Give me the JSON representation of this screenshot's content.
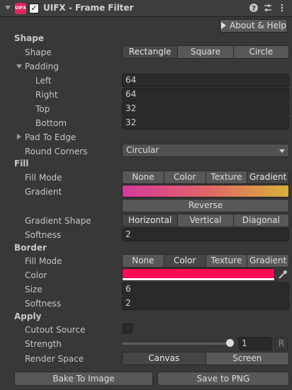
{
  "header": {
    "logo_text": "UIFX",
    "enabled": true,
    "title": "UIFX - Frame Filter",
    "icons": [
      "help-icon",
      "preset-icon",
      "menu-icon"
    ]
  },
  "about_button": "About & Help",
  "shape": {
    "section": "Shape",
    "shape_label": "Shape",
    "options": [
      "Rectangle",
      "Square",
      "Circle"
    ],
    "selected": "Rectangle",
    "padding_label": "Padding",
    "padding": {
      "left_label": "Left",
      "left": "64",
      "right_label": "Right",
      "right": "64",
      "top_label": "Top",
      "top": "32",
      "bottom_label": "Bottom",
      "bottom": "32"
    },
    "pad_to_edge_label": "Pad To Edge",
    "round_corners_label": "Round Corners",
    "round_corners_value": "Circular"
  },
  "fill": {
    "section": "Fill",
    "mode_label": "Fill Mode",
    "mode_options": [
      "None",
      "Color",
      "Texture",
      "Gradient"
    ],
    "mode_selected": "Gradient",
    "gradient_label": "Gradient",
    "gradient_colors": [
      "#d63a9a",
      "#e0646a",
      "#d9b03a"
    ],
    "reverse_button": "Reverse",
    "gradient_shape_label": "Gradient Shape",
    "gradient_shape_options": [
      "Horizontal",
      "Vertical",
      "Diagonal"
    ],
    "gradient_shape_selected": "Horizontal",
    "softness_label": "Softness",
    "softness": "2"
  },
  "border": {
    "section": "Border",
    "mode_label": "Fill Mode",
    "mode_options": [
      "None",
      "Color",
      "Texture",
      "Gradient"
    ],
    "mode_selected": "Color",
    "color_label": "Color",
    "color": "#ff0b55",
    "size_label": "Size",
    "size": "6",
    "softness_label": "Softness",
    "softness": "2"
  },
  "apply": {
    "section": "Apply",
    "cutout_label": "Cutout Source",
    "cutout_checked": false,
    "strength_label": "Strength",
    "strength": "1",
    "strength_fraction": 1.0,
    "reset_label": "R",
    "render_space_label": "Render Space",
    "render_space_options": [
      "Canvas",
      "Screen"
    ],
    "render_space_selected": "Canvas"
  },
  "footer": {
    "bake_button": "Bake To Image",
    "save_button": "Save to PNG"
  }
}
